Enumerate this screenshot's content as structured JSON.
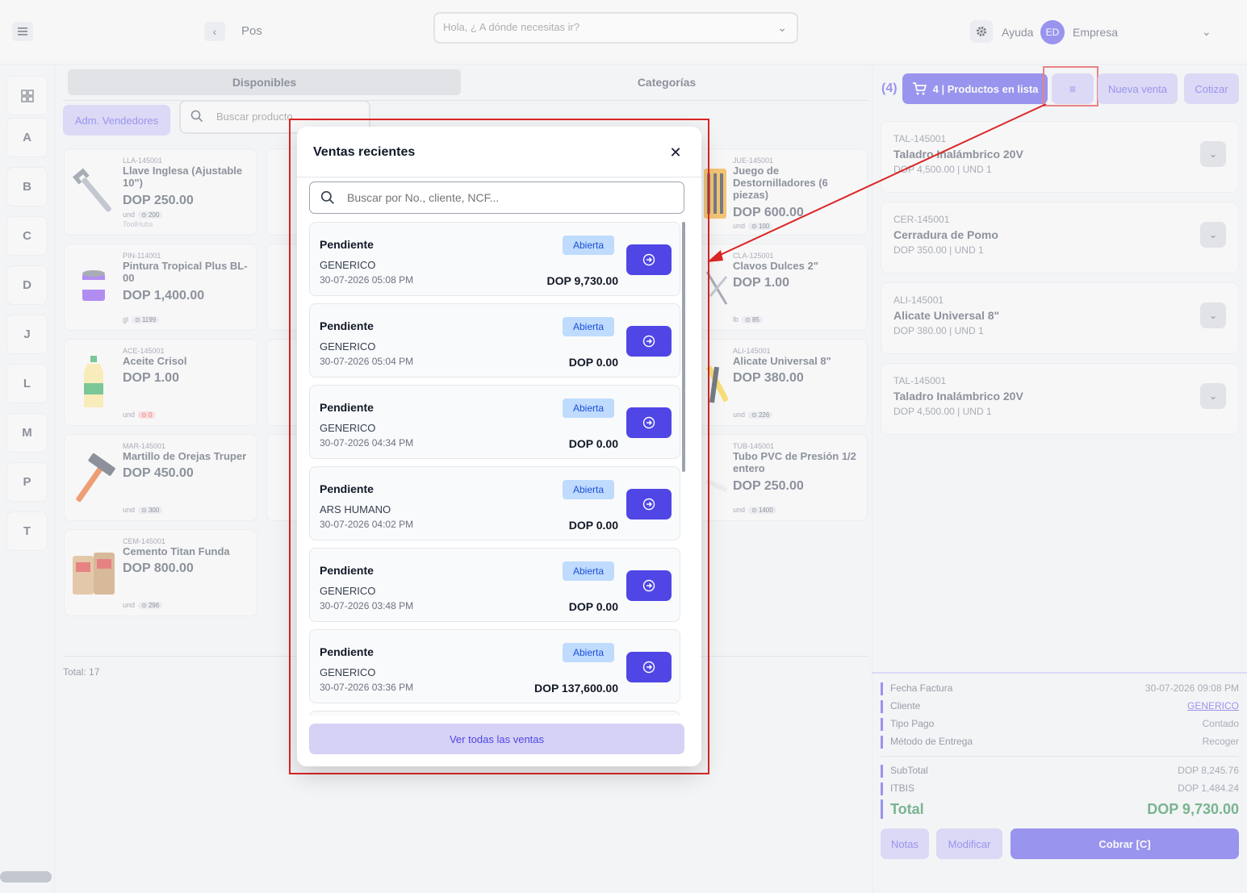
{
  "topbar": {
    "page_title": "Pos",
    "search_placeholder": "Hola, ¿ A dónde necesitas ir?",
    "help_label": "Ayuda",
    "avatar_initials": "ED",
    "company_label": "Empresa"
  },
  "letters": [
    "A",
    "B",
    "C",
    "D",
    "J",
    "L",
    "M",
    "P",
    "T"
  ],
  "catalog": {
    "tabs": [
      {
        "label": "Disponibles",
        "active": true
      },
      {
        "label": "Categorías",
        "active": false
      }
    ],
    "vendors_button": "Adm. Vendedores",
    "search_placeholder": "Buscar producto",
    "products": [
      {
        "code": "LLA-145001",
        "name": "Llave Inglesa (Ajustable 10\")",
        "price": "DOP 250.00",
        "unit": "und",
        "stock": "200",
        "brand": "ToolHubs"
      },
      {
        "code": "JUE-145001",
        "name": "Juego de Destornilladores (6 piezas)",
        "price": "DOP 600.00",
        "unit": "und",
        "stock": "100",
        "brand": ""
      },
      {
        "code": "PIN-114001",
        "name": "Pintura Tropical Plus BL-00",
        "price": "DOP 1,400.00",
        "unit": "gl",
        "stock": "1199",
        "brand": ""
      },
      {
        "code": "CLA-125001",
        "name": "Clavos Dulces 2\"",
        "price": "DOP 1.00",
        "unit": "lb",
        "stock": "85",
        "brand": ""
      },
      {
        "code": "ACE-145001",
        "name": "Aceite Crisol",
        "price": "DOP 1.00",
        "unit": "und",
        "stock": "0",
        "brand": ""
      },
      {
        "code": "ALI-145001",
        "name": "Alicate Universal 8\"",
        "price": "DOP 380.00",
        "unit": "und",
        "stock": "226",
        "brand": ""
      },
      {
        "code": "MAR-145001",
        "name": "Martillo de Orejas Truper",
        "price": "DOP 450.00",
        "unit": "und",
        "stock": "300",
        "brand": ""
      },
      {
        "code": "TUB-145001",
        "name": "Tubo PVC de Presión 1/2 entero",
        "price": "DOP 250.00",
        "unit": "und",
        "stock": "1400",
        "brand": ""
      },
      {
        "code": "CEM-145001",
        "name": "Cemento Titan Funda",
        "price": "DOP 800.00",
        "unit": "und",
        "stock": "296",
        "brand": ""
      }
    ],
    "total_label": "Total: 17"
  },
  "cart": {
    "count_label": "(4)",
    "cart_button": "4 | Productos en lista",
    "new_sale_button": "Nueva venta",
    "quote_button": "Cotizar",
    "items": [
      {
        "code": "TAL-145001",
        "name": "Taladro Inalámbrico 20V",
        "sub": "DOP 4,500.00 | UND 1"
      },
      {
        "code": "CER-145001",
        "name": "Cerradura de Pomo",
        "sub": "DOP 350.00 | UND 1"
      },
      {
        "code": "ALI-145001",
        "name": "Alicate Universal 8\"",
        "sub": "DOP 380.00 | UND 1"
      },
      {
        "code": "TAL-145001",
        "name": "Taladro Inalámbrico 20V",
        "sub": "DOP 4,500.00 | UND 1"
      }
    ]
  },
  "summary": {
    "rows": [
      {
        "label": "Fecha Factura",
        "value": "30-07-2026 09:08 PM"
      },
      {
        "label": "Cliente",
        "value": "GENERICO"
      },
      {
        "label": "Tipo Pago",
        "value": "Contado"
      },
      {
        "label": "Método de Entrega",
        "value": "Recoger"
      }
    ],
    "subtotal_label": "SubTotal",
    "subtotal_value": "DOP 8,245.76",
    "itbis_label": "ITBIS",
    "itbis_value": "DOP 1,484.24",
    "total_label": "Total",
    "total_value": "DOP 9,730.00",
    "notes_button": "Notas",
    "modify_button": "Modificar",
    "charge_button": "Cobrar [C]"
  },
  "modal": {
    "title": "Ventas recientes",
    "search_placeholder": "Buscar por No., cliente, NCF...",
    "view_all_button": "Ver todas las ventas",
    "sales": [
      {
        "status": "Pendiente",
        "badge": "Abierta",
        "client": "GENERICO",
        "date": "30-07-2026 05:08 PM",
        "amount": "DOP 9,730.00"
      },
      {
        "status": "Pendiente",
        "badge": "Abierta",
        "client": "GENERICO",
        "date": "30-07-2026 05:04 PM",
        "amount": "DOP 0.00"
      },
      {
        "status": "Pendiente",
        "badge": "Abierta",
        "client": "GENERICO",
        "date": "30-07-2026 04:34 PM",
        "amount": "DOP 0.00"
      },
      {
        "status": "Pendiente",
        "badge": "Abierta",
        "client": "ARS HUMANO",
        "date": "30-07-2026 04:02 PM",
        "amount": "DOP 0.00"
      },
      {
        "status": "Pendiente",
        "badge": "Abierta",
        "client": "GENERICO",
        "date": "30-07-2026 03:48 PM",
        "amount": "DOP 0.00"
      },
      {
        "status": "Pendiente",
        "badge": "Abierta",
        "client": "GENERICO",
        "date": "30-07-2026 03:36 PM",
        "amount": "DOP 137,600.00"
      }
    ]
  },
  "colors": {
    "primary": "#4f46e5",
    "primary_light": "#c7c4f5",
    "annotation": "#dc2626",
    "badge_bg": "#bfdbfe",
    "total_green": "#15803d"
  }
}
